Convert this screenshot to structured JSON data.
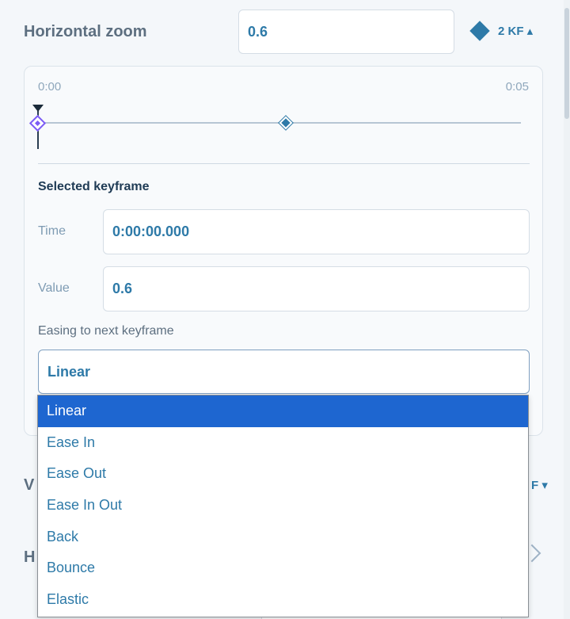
{
  "property": {
    "label": "Horizontal zoom",
    "value": "0.6",
    "kf_toggle": "2 KF ▴"
  },
  "timeline": {
    "start_time": "0:00",
    "end_time": "0:05"
  },
  "selected_keyframe": {
    "title": "Selected keyframe",
    "time_label": "Time",
    "time_value": "0:00:00.000",
    "value_label": "Value",
    "value_value": "0.6",
    "easing_label": "Easing to next keyframe",
    "easing_selected": "Linear"
  },
  "easing_options": [
    "Linear",
    "Ease In",
    "Ease Out",
    "Ease In Out",
    "Back",
    "Bounce",
    "Elastic"
  ],
  "behind": {
    "row1_label_fragment": "V",
    "row1_kf_fragment": "F ▾",
    "row2_label_fragment": "H"
  },
  "colors": {
    "accent": "#2e7aa8",
    "selected_option_bg": "#1e66d0",
    "selected_keyframe": "#7c5cf5"
  }
}
